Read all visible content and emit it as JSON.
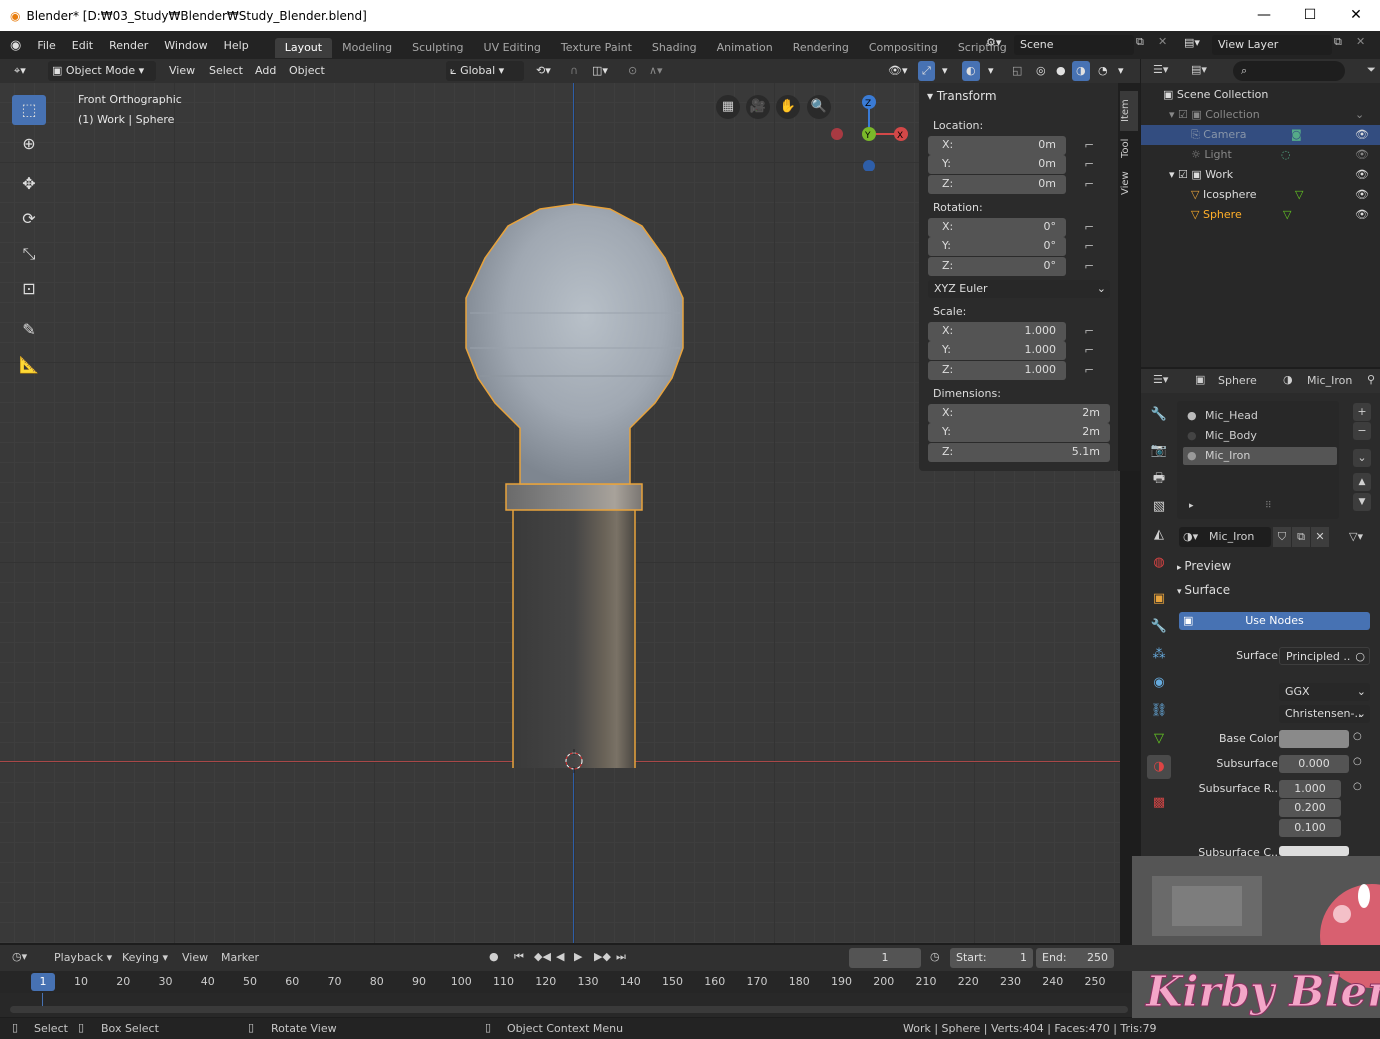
{
  "window": {
    "title": "Blender* [D:₩03_Study₩Blender₩Study_Blender.blend]",
    "minimize": "—",
    "maximize": "☐",
    "close": "✕"
  },
  "menu": {
    "items": [
      "File",
      "Edit",
      "Render",
      "Window",
      "Help"
    ]
  },
  "workspaces": [
    "Layout",
    "Modeling",
    "Sculpting",
    "UV Editing",
    "Texture Paint",
    "Shading",
    "Animation",
    "Rendering",
    "Compositing",
    "Scripting"
  ],
  "active_workspace": "Layout",
  "scene": {
    "name": "Scene"
  },
  "view_layer": {
    "name": "View Layer"
  },
  "viewport_header": {
    "mode": "Object Mode",
    "menus": [
      "View",
      "Select",
      "Add",
      "Object"
    ],
    "orientation": "Global"
  },
  "viewport": {
    "view_name": "Front Orthographic",
    "collection_info": "(1) Work | Sphere",
    "gizmo": {
      "z": "Z",
      "y": "Y",
      "x": "X"
    }
  },
  "npanel": {
    "title": "Transform",
    "location_label": "Location:",
    "location": {
      "x": "0m",
      "y": "0m",
      "z": "0m"
    },
    "rotation_label": "Rotation:",
    "rotation": {
      "x": "0°",
      "y": "0°",
      "z": "0°"
    },
    "rotation_mode": "XYZ Euler",
    "scale_label": "Scale:",
    "scale": {
      "x": "1.000",
      "y": "1.000",
      "z": "1.000"
    },
    "dimensions_label": "Dimensions:",
    "dimensions": {
      "x": "2m",
      "y": "2m",
      "z": "5.1m"
    },
    "axis": {
      "x": "X:",
      "y": "Y:",
      "z": "Z:"
    },
    "tabs": [
      "Item",
      "Tool",
      "View"
    ]
  },
  "outliner": {
    "root": "Scene Collection",
    "items": [
      {
        "label": "Collection"
      },
      {
        "label": "Camera"
      },
      {
        "label": "Light"
      },
      {
        "label": "Work"
      },
      {
        "label": "Icosphere"
      },
      {
        "label": "Sphere"
      }
    ]
  },
  "properties": {
    "object": "Sphere",
    "material": "Mic_Iron",
    "slots": [
      "Mic_Head",
      "Mic_Body",
      "Mic_Iron"
    ],
    "active_slot": "Mic_Iron",
    "material_name": "Mic_Iron",
    "preview_label": "Preview",
    "surface_panel": "Surface",
    "use_nodes": "Use Nodes",
    "surface_label": "Surface",
    "surface_value": "Principled ..",
    "distribution": "GGX",
    "subsurface_method": "Christensen-..",
    "base_color_label": "Base Color",
    "base_color": "#8a8a8a",
    "subsurface_label": "Subsurface",
    "subsurface": "0.000",
    "subsurface_radius_label": "Subsurface R..",
    "subsurface_radius": [
      "1.000",
      "0.200",
      "0.100"
    ],
    "subsurface_color_label": "Subsurface C.."
  },
  "timeline": {
    "menus": [
      "Playback",
      "Keying",
      "View",
      "Marker"
    ],
    "current_frame": "1",
    "start_label": "Start:",
    "start": "1",
    "end_label": "End:",
    "end": "250",
    "ticks": [
      "1",
      "10",
      "20",
      "30",
      "40",
      "50",
      "60",
      "70",
      "80",
      "90",
      "100",
      "110",
      "120",
      "130",
      "140",
      "150",
      "160",
      "170",
      "180",
      "190",
      "200",
      "210",
      "220",
      "230",
      "240",
      "250"
    ]
  },
  "statusbar": {
    "select": "Select",
    "box_select": "Box Select",
    "rotate": "Rotate View",
    "context": "Object Context Menu",
    "stats": "Work | Sphere | Verts:404 | Faces:470 | Tris:79"
  },
  "overlay_image": {
    "text": "Kirby Blender Rig"
  },
  "colors": {
    "accent": "#4772b3",
    "selected_outline": "#e8a33c",
    "active_text": "#ffaf29"
  }
}
